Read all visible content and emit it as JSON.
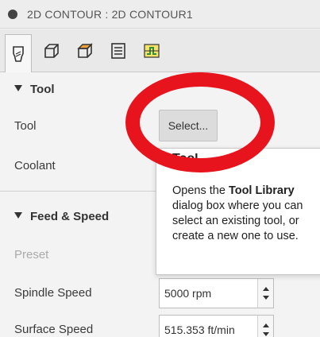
{
  "header": {
    "title": "2D CONTOUR : 2D CONTOUR1"
  },
  "tabs": [
    {
      "icon": "tool-icon",
      "active": true
    },
    {
      "icon": "geometry-box-icon"
    },
    {
      "icon": "heights-box-icon"
    },
    {
      "icon": "passes-list-icon"
    },
    {
      "icon": "linking-icon"
    }
  ],
  "tool_section": {
    "header": "Tool",
    "tool_label": "Tool",
    "select_label": "Select...",
    "coolant_label": "Coolant"
  },
  "feed_section": {
    "header": "Feed & Speed",
    "preset_label": "Preset",
    "spindle_label": "Spindle Speed",
    "spindle_value": "5000 rpm",
    "surface_label": "Surface Speed",
    "surface_value": "515.353 ft/min"
  },
  "tooltip": {
    "heading": "Tool",
    "line1_prefix": "Opens the ",
    "line1_bold": "Tool Library",
    "line2": "dialog box where you can",
    "line3": "select an existing tool, or",
    "line4": "create a new one to use."
  },
  "colors": {
    "highlight_ring": "#e8141d"
  }
}
